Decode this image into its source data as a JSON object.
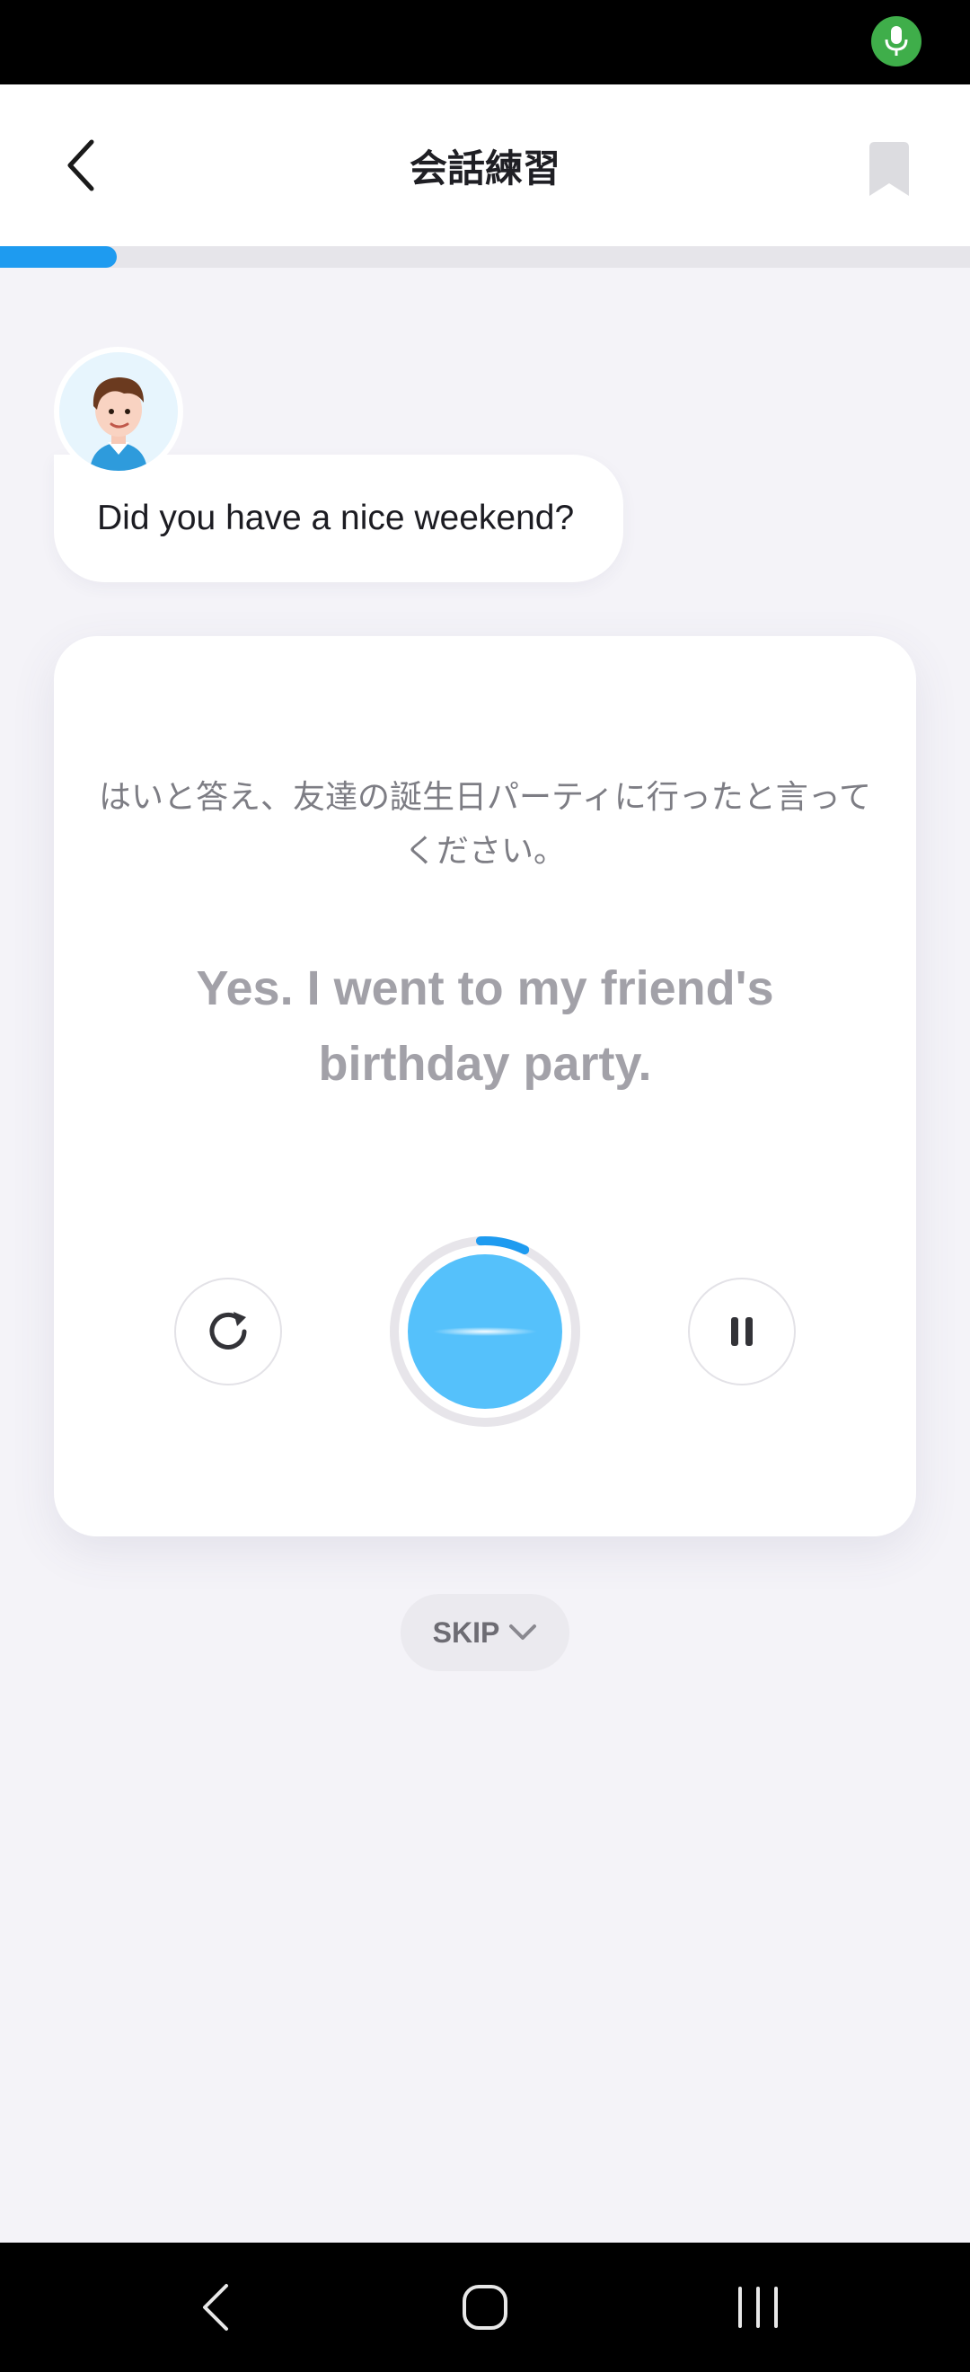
{
  "header": {
    "title": "会話練習"
  },
  "progress": {
    "value_fraction": 0.12
  },
  "conversation": {
    "partner_message": "Did you have a nice weekend?"
  },
  "practice": {
    "instruction": "はいと答え、友達の誕生日パーティに行ったと言ってください。",
    "target_sentence": "Yes. I went to my friend's birthday party.",
    "record_progress_fraction": 0.08
  },
  "skip": {
    "label": "SKIP"
  },
  "colors": {
    "accent": "#1e9bf0",
    "record_button": "#55c1fb",
    "mic_indicator": "#3fae4a"
  }
}
